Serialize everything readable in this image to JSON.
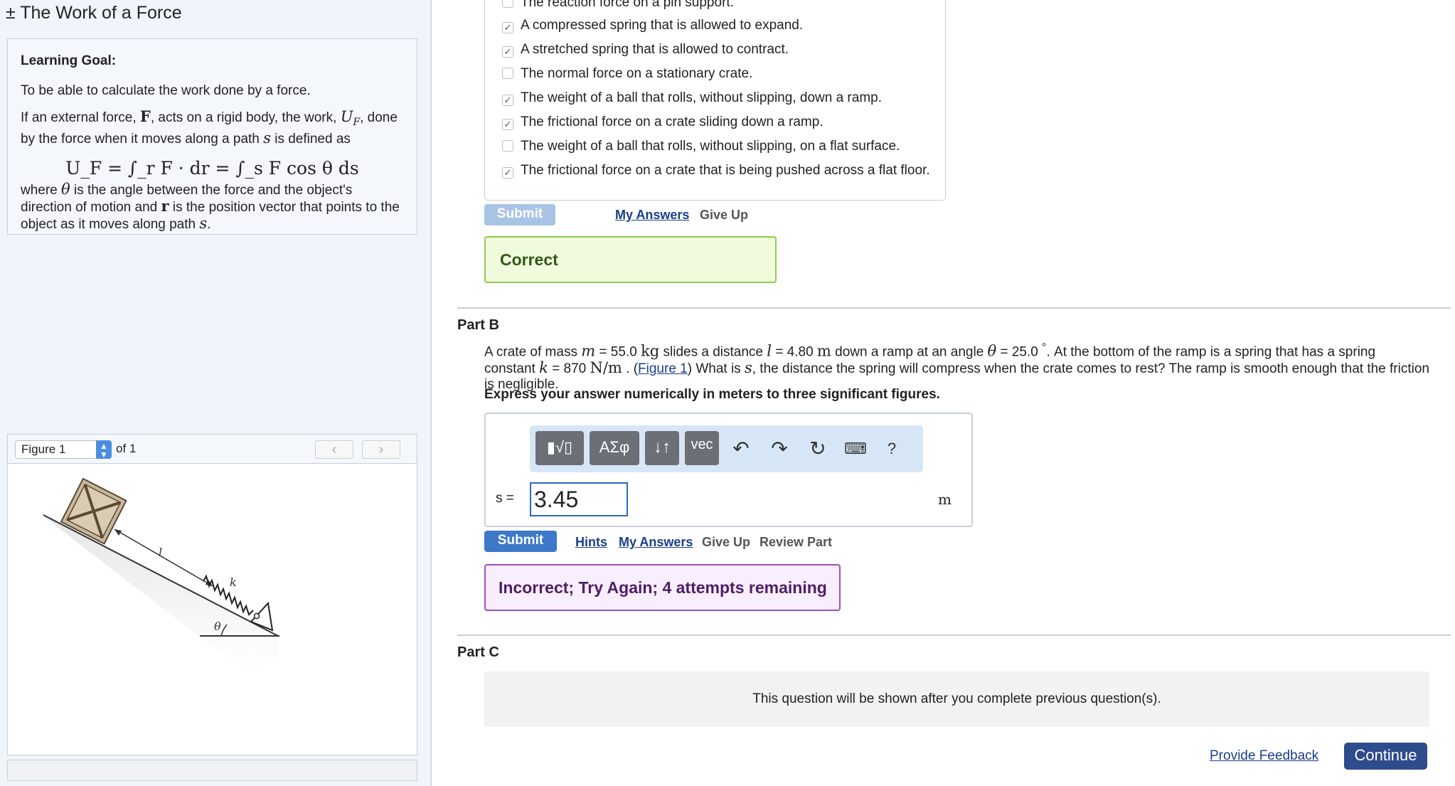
{
  "assignment": {
    "title": "± The Work of a Force"
  },
  "learning_goal": {
    "title": "Learning Goal:",
    "p1": "To be able to calculate the work done by a force.",
    "p2_a": "If an external force, ",
    "p2_F": "F",
    "p2_b": ", acts on a rigid body, the work, ",
    "p2_U": "U",
    "p2_Usub": "F",
    "p2_c": ", done by the force when it moves along a path ",
    "p2_s": "s",
    "p2_d": " is defined as",
    "equation": "U_F = ∫_r F · dr = ∫_s F cos θ ds",
    "p3_a": "where ",
    "p3_theta": "θ",
    "p3_b": " is the angle between the force and the object's direction of motion and ",
    "p3_r": "r",
    "p3_c": " is the position vector that points to the object as it moves along path ",
    "p3_s": "s",
    "p3_d": "."
  },
  "figure": {
    "select_value": "Figure 1",
    "of_label": "of 1",
    "prev_icon": "chevron-left-icon",
    "next_icon": "chevron-right-icon",
    "label_l": "l",
    "label_k": "k",
    "label_theta": "θ"
  },
  "part_a": {
    "choices": [
      {
        "label": "The reaction force on a pin support.",
        "checked": false
      },
      {
        "label": "A compressed spring that is allowed to expand.",
        "checked": true
      },
      {
        "label": "A stretched spring that is allowed to contract.",
        "checked": true
      },
      {
        "label": "The normal force on a stationary crate.",
        "checked": false
      },
      {
        "label": "The weight of a ball that rolls, without slipping, down a ramp.",
        "checked": true
      },
      {
        "label": "The frictional force on a crate sliding down a ramp.",
        "checked": true
      },
      {
        "label": "The weight of a ball that rolls, without slipping, on a flat surface.",
        "checked": false
      },
      {
        "label": "The frictional force on a crate that is being pushed across a flat floor.",
        "checked": true
      }
    ],
    "submit_label": "Submit",
    "my_answers": "My Answers",
    "give_up": "Give Up",
    "feedback": "Correct"
  },
  "part_b": {
    "title": "Part B",
    "problem": {
      "t1": "A crate of mass ",
      "m": "m",
      "t2": " = 55.0 ",
      "kg": "kg",
      "t3": " slides a distance ",
      "l": "l",
      "t4": " = 4.80 ",
      "m_unit": "m",
      "t5": " down a ramp at an angle ",
      "theta": "θ",
      "t6": " = 25.0 ",
      "deg": "°",
      "t7": ". At the bottom of the ramp is a spring that has a spring constant ",
      "k": "k",
      "t8": " = 870 ",
      "Nm": "N/m",
      "t9": " . (",
      "figure_link": "Figure 1",
      "t10": ") What is ",
      "s": "s",
      "t11": ", the distance the spring will compress when the crate comes to rest? The ramp is smooth enough that the friction is negligible."
    },
    "instruction": "Express your answer numerically in meters to three significant figures.",
    "toolbar": {
      "templates": "▮√▯",
      "greek": "ΑΣφ",
      "arrows": "↓↑",
      "vec": "vec",
      "undo_icon": "undo-icon",
      "redo_icon": "redo-icon",
      "reset_icon": "reset-icon",
      "keyboard_icon": "keyboard-icon",
      "help": "?"
    },
    "answer_label": "s =",
    "answer_value": "3.45",
    "unit": "m",
    "submit_label": "Submit",
    "hints": "Hints",
    "my_answers": "My Answers",
    "give_up": "Give Up",
    "review_part": "Review Part",
    "feedback": "Incorrect; Try Again; 4 attempts remaining"
  },
  "part_c": {
    "title": "Part C",
    "locked_message": "This question will be shown after you complete previous question(s)."
  },
  "footer": {
    "provide_feedback": "Provide Feedback",
    "continue": "Continue"
  },
  "colors": {
    "submit_disabled": "#a9c3e6",
    "submit_active": "#3d78c9",
    "correct_border": "#8ccf4d",
    "incorrect_border": "#9d4fc0",
    "continue_bg": "#2e4b8b",
    "link": "#1a3e8a"
  }
}
